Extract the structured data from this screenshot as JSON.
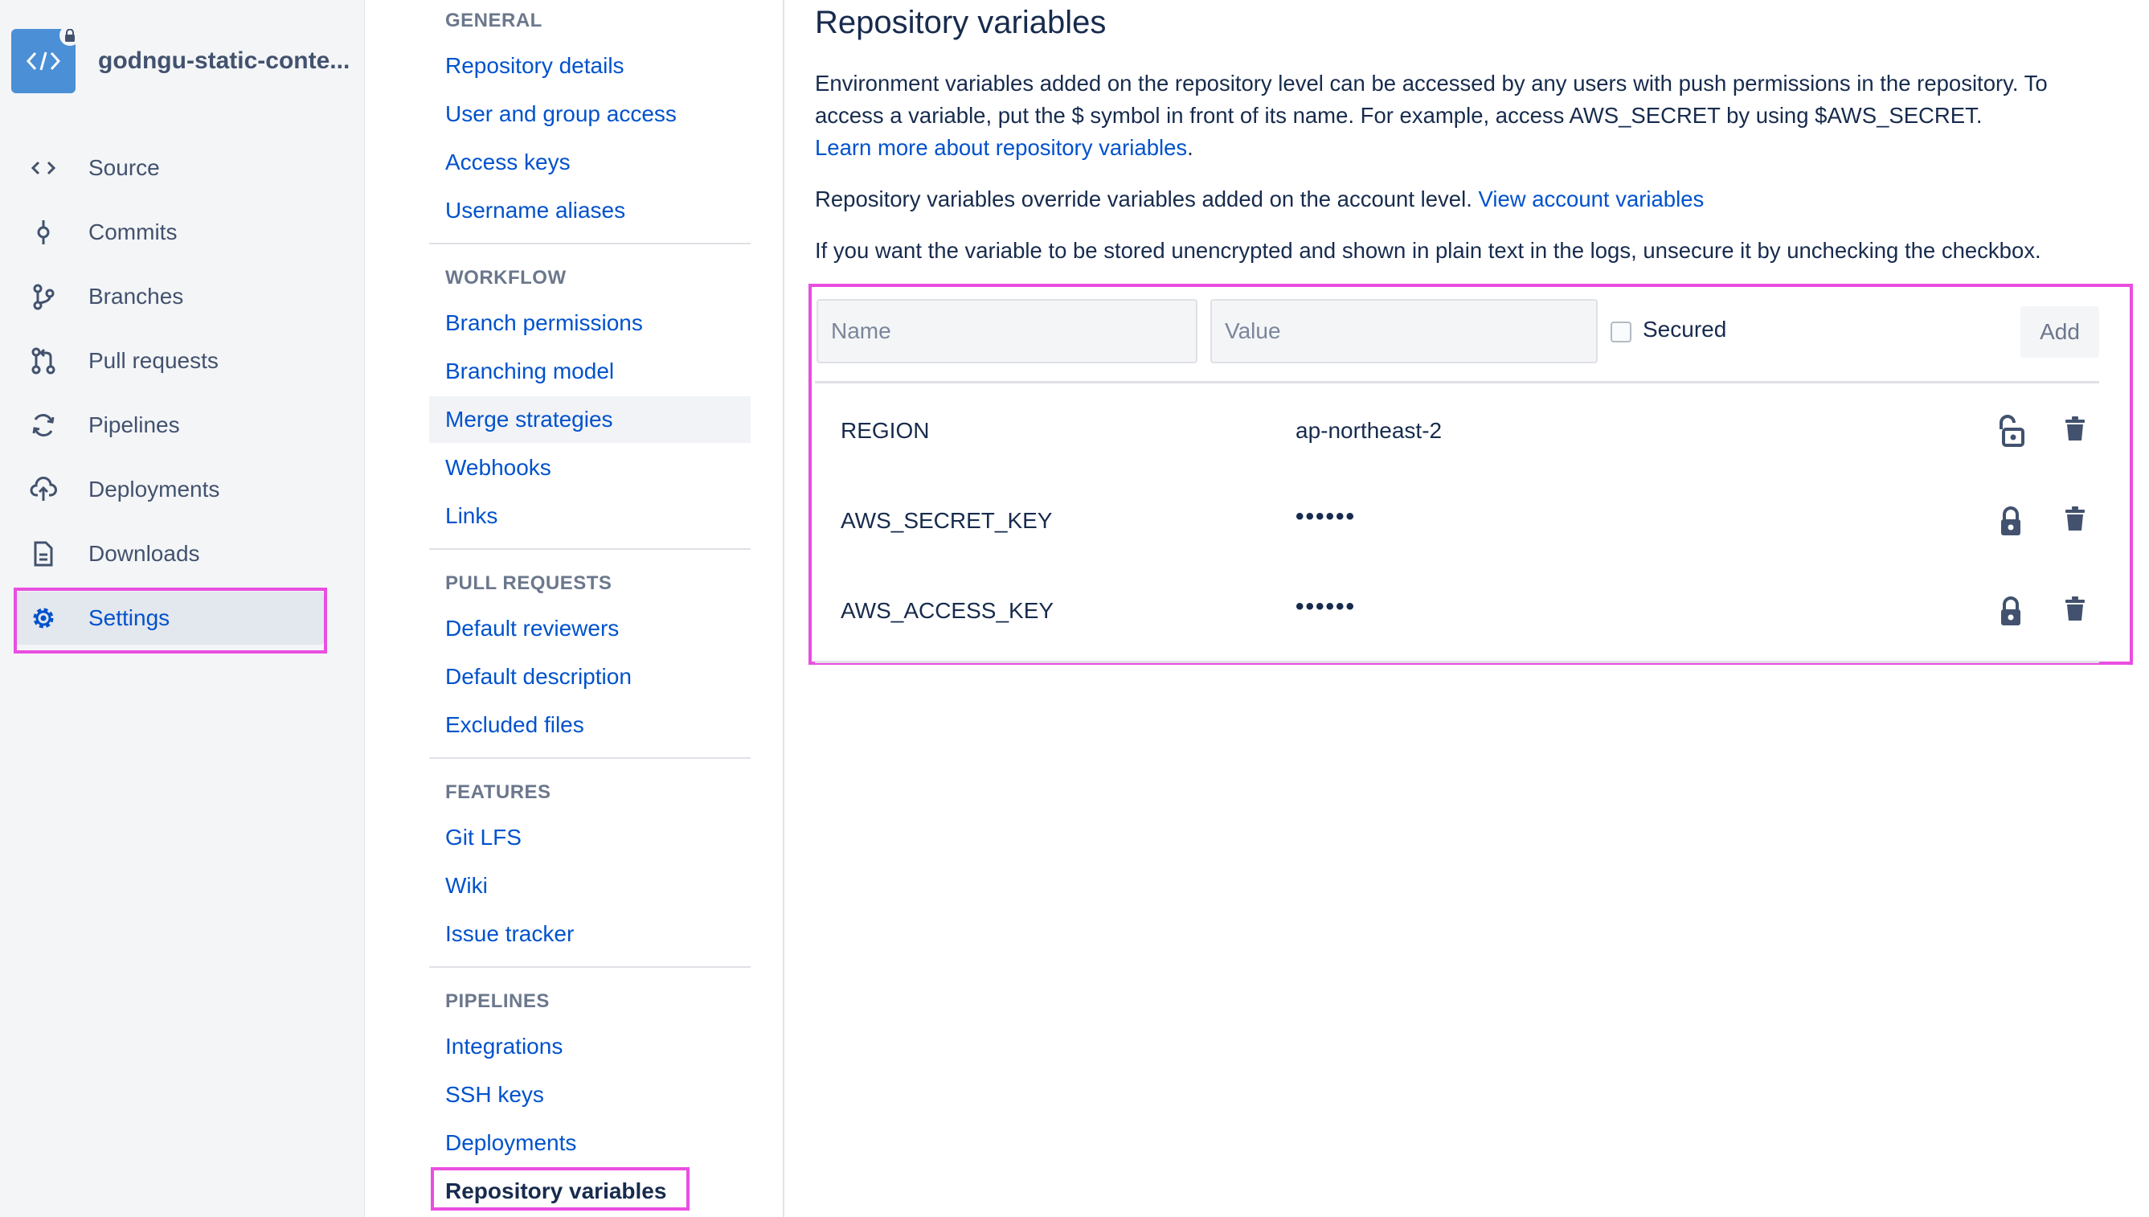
{
  "repo": {
    "name": "godngu-static-conte..."
  },
  "sidebar": {
    "items": [
      {
        "label": "Source",
        "icon": "code-icon"
      },
      {
        "label": "Commits",
        "icon": "commit-icon"
      },
      {
        "label": "Branches",
        "icon": "branch-icon"
      },
      {
        "label": "Pull requests",
        "icon": "pull-request-icon"
      },
      {
        "label": "Pipelines",
        "icon": "pipelines-icon"
      },
      {
        "label": "Deployments",
        "icon": "cloud-upload-icon"
      },
      {
        "label": "Downloads",
        "icon": "document-icon"
      },
      {
        "label": "Settings",
        "icon": "gear-icon",
        "active": true
      }
    ]
  },
  "settings_nav": {
    "sections": [
      {
        "title": "GENERAL",
        "links": [
          "Repository details",
          "User and group access",
          "Access keys",
          "Username aliases"
        ]
      },
      {
        "title": "WORKFLOW",
        "links": [
          "Branch permissions",
          "Branching model",
          "Merge strategies",
          "Webhooks",
          "Links"
        ]
      },
      {
        "title": "PULL REQUESTS",
        "links": [
          "Default reviewers",
          "Default description",
          "Excluded files"
        ]
      },
      {
        "title": "FEATURES",
        "links": [
          "Git LFS",
          "Wiki",
          "Issue tracker"
        ]
      },
      {
        "title": "PIPELINES",
        "links": [
          "Integrations",
          "SSH keys",
          "Deployments",
          "Repository variables"
        ]
      }
    ]
  },
  "main": {
    "title": "Repository variables",
    "intro_text": "Environment variables added on the repository level can be accessed by any users with push permissions in the repository. To access a variable, put the $ symbol in front of its name. For example, access AWS_SECRET by using $AWS_SECRET.",
    "learn_more_link": "Learn more about repository variables",
    "learn_more_suffix": ".",
    "override_text": "Repository variables override variables added on the account level.",
    "view_account_link": "View account variables",
    "unsecure_text": "If you want the variable to be stored unencrypted and shown in plain text in the logs, unsecure it by unchecking the checkbox.",
    "form": {
      "name_placeholder": "Name",
      "value_placeholder": "Value",
      "secured_label": "Secured",
      "add_label": "Add"
    },
    "variables": [
      {
        "name": "REGION",
        "value": "ap-northeast-2",
        "secured": false
      },
      {
        "name": "AWS_SECRET_KEY",
        "value": "••••••",
        "secured": true
      },
      {
        "name": "AWS_ACCESS_KEY",
        "value": "••••••",
        "secured": true
      }
    ]
  },
  "colors": {
    "link": "#0052cc",
    "highlight": "#e94ee0",
    "text": "#172b4d",
    "sidebar_bg": "#f4f5f7"
  }
}
